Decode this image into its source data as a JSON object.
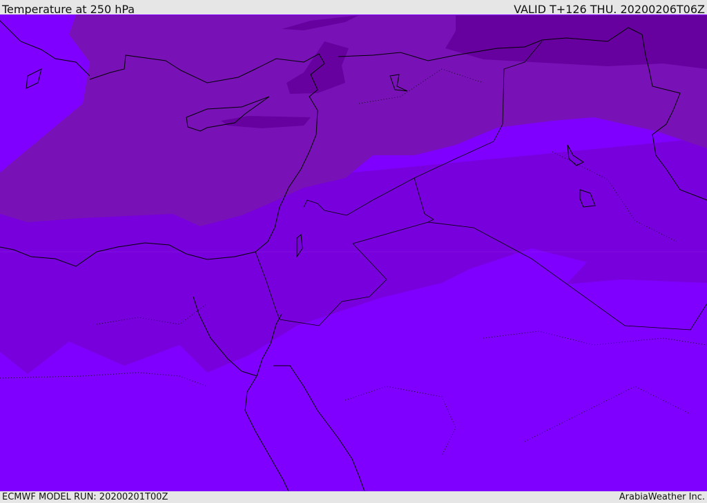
{
  "header": {
    "title": "Temperature at 250 hPa",
    "valid": "VALID T+126 THU. 20200206T06Z"
  },
  "footer": {
    "model_run": "ECMWF MODEL RUN: 20200201T00Z",
    "credit": "ArabiaWeather Inc."
  },
  "colors": {
    "coldest": "#66009e",
    "cold": "#7812b6",
    "mid": "#7800dc",
    "warm": "#7f00ff",
    "coast": "#000000"
  }
}
